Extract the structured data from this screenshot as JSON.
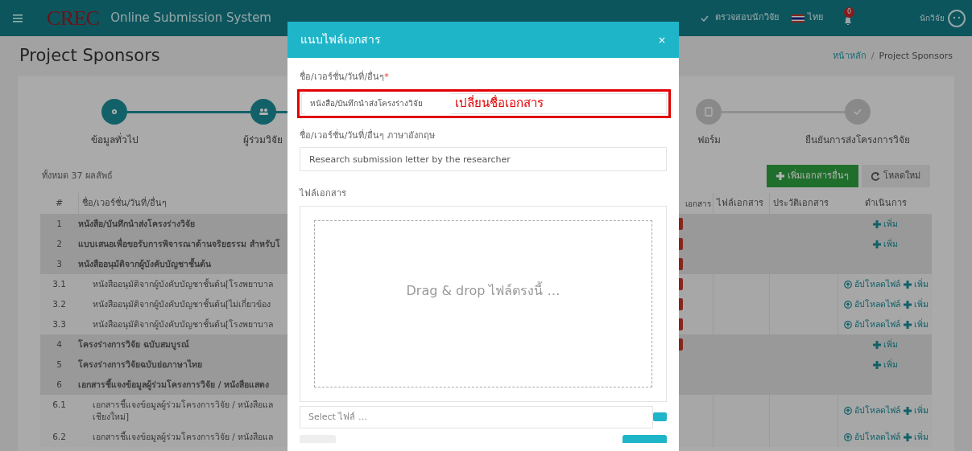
{
  "header": {
    "logo": "CREC",
    "app_title": "Online Submission System",
    "nav_item": "ตรวจสอบนักวิจัย",
    "language": "ไทย",
    "notification_count": "0",
    "user": "นักวิจัย"
  },
  "page_title": "Project Sponsors",
  "breadcrumb": [
    "หน้าหลัก",
    "Project Sponsors"
  ],
  "breadcrumb_separator": "/",
  "steps": [
    {
      "label": "ข้อมูลทั่วไป",
      "done": true
    },
    {
      "label": "ผู้ร่วมวิจัย",
      "done": true
    },
    {
      "label": "ฟอร์ม",
      "done": false
    },
    {
      "label": "ยืนยันการส่งโครงการวิจัย",
      "done": false
    }
  ],
  "result_count": "ทั้งหมด 37 ผลลัพธ์",
  "toolbar": {
    "add_button": "เพิ่มเอกสารอื่นๆ",
    "reload_button": "โหลดใหม่"
  },
  "table": {
    "columns": [
      "#",
      "ชื่อ/เวอร์ชั่น/วันที่/อื่นๆ",
      "เอกสาร",
      "ไฟล์เอกสาร",
      "ประวัติเอกสาร",
      "ดำเนินการ"
    ],
    "rows": [
      {
        "num": "1",
        "name": [
          "หนังสือ/บันทึกนำส่งโครงร่างวิจัย"
        ],
        "group": true,
        "badge": true,
        "actions": [
          {
            "kind": "add",
            "label": "เพิ่ม"
          }
        ]
      },
      {
        "num": "2",
        "name": [
          "แบบเสนอเพื่อขอรับการพิจารณาด้านจริยธรรม สำหรับโ"
        ],
        "group": true,
        "badge": true,
        "actions": [
          {
            "kind": "add",
            "label": "เพิ่ม"
          }
        ]
      },
      {
        "num": "3",
        "name": [
          "หนังสืออนุมัติจากผู้บังคับบัญชาชั้นต้น"
        ],
        "group": true,
        "badge": true,
        "actions": []
      },
      {
        "num": "3.1",
        "name": [
          "หนังสืออนุมัติจากผู้บังคับบัญชาชั้นต้น[โรงพยาบาล"
        ],
        "group": false,
        "badge": true,
        "actions": [
          {
            "kind": "upload",
            "label": "อัปโหลดไฟล์"
          },
          {
            "kind": "add",
            "label": "เพิ่ม"
          }
        ]
      },
      {
        "num": "3.2",
        "name": [
          "หนังสืออนุมัติจากผู้บังคับบัญชาชั้นต้น[ไม่เกี่ยวข้อง"
        ],
        "group": false,
        "badge": true,
        "actions": [
          {
            "kind": "upload",
            "label": "อัปโหลดไฟล์"
          },
          {
            "kind": "add",
            "label": "เพิ่ม"
          }
        ]
      },
      {
        "num": "3.3",
        "name": [
          "หนังสืออนุมัติจากผู้บังคับบัญชาชั้นต้น[โรงพยาบาล"
        ],
        "group": false,
        "badge": true,
        "actions": [
          {
            "kind": "upload",
            "label": "อัปโหลดไฟล์"
          },
          {
            "kind": "add",
            "label": "เพิ่ม"
          }
        ]
      },
      {
        "num": "4",
        "name": [
          "โครงร่างการวิจัย ฉบับสมบูรณ์"
        ],
        "group": true,
        "badge": true,
        "actions": [
          {
            "kind": "add",
            "label": "เพิ่ม"
          }
        ]
      },
      {
        "num": "5",
        "name": [
          "โครงร่างการวิจัยฉบับย่อภาษาไทย"
        ],
        "group": true,
        "badge": false,
        "actions": [
          {
            "kind": "add",
            "label": "เพิ่ม"
          }
        ]
      },
      {
        "num": "6",
        "name": [
          "เอกสารชี้แจงข้อมูลผู้ร่วมโครงการวิจัย / หนังสือแสดง"
        ],
        "group": true,
        "badge": false,
        "actions": []
      },
      {
        "num": "6.1",
        "name": [
          "เอกสารชี้แจงข้อมูลผู้ร่วมโครงการวิจัย / หนังสือแล",
          "เชียงใหม่]"
        ],
        "group": false,
        "badge": false,
        "actions": [
          {
            "kind": "upload",
            "label": "อัปโหลดไฟล์"
          },
          {
            "kind": "add",
            "label": "เพิ่ม"
          }
        ]
      },
      {
        "num": "6.2",
        "name": [
          "เอกสารชี้แจงข้อมูลผู้ร่วมโครงการวิจัย / หนังสือแล"
        ],
        "group": false,
        "badge": false,
        "actions": [
          {
            "kind": "upload",
            "label": "อัปโหลดไฟล์"
          },
          {
            "kind": "add",
            "label": "เพิ่ม"
          }
        ]
      }
    ]
  },
  "modal": {
    "title": "แนบไฟล์เอกสาร",
    "close": "×",
    "name_label": "ชื่อ/เวอร์ชั่น/วันที่/อื่นๆ",
    "required": true,
    "required_mark": "*",
    "name_value": "หนังสือ/บันทึกนำส่งโครงร่างวิจัย",
    "annotation": "เปลี่ยนชื่อเอกสาร",
    "english_label": "ชื่อ/เวอร์ชั่น/วันที่/อื่นๆ ภาษาอังกฤษ",
    "english_value": "Research submission letter by the researcher",
    "file_label": "ไฟล์เอกสาร",
    "dropzone_text": "Drag & drop ไฟล์ตรงนี้ …",
    "file_placeholder": "Select ไฟล์ …"
  }
}
